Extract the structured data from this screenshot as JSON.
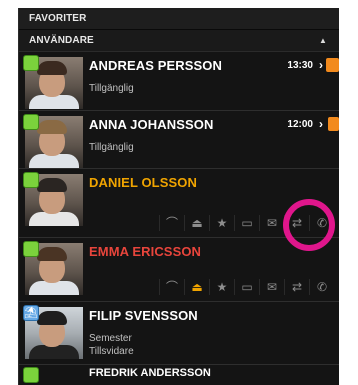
{
  "sections": {
    "favorites": "FAVORITER",
    "users": "ANVÄNDARE"
  },
  "contacts": [
    {
      "name": "ANDREAS PERSSON",
      "status_text": "Tillgänglig",
      "time": "13:30"
    },
    {
      "name": "ANNA JOHANSSON",
      "status_text": "Tillgänglig",
      "time": "12:00"
    },
    {
      "name": "DANIEL  OLSSON"
    },
    {
      "name": "EMMA ERICSSON"
    },
    {
      "name": "FILIP SVENSSON",
      "status_text": "Semester",
      "status_text2": "Tillsvidare"
    },
    {
      "name": "FREDRIK ANDERSSON"
    }
  ],
  "colors": {
    "available": "#7bd23c",
    "away": "#66a9e6",
    "accent_orange": "#f0a400",
    "accent_red": "#e8453c",
    "highlight_ring": "#e0168c"
  }
}
